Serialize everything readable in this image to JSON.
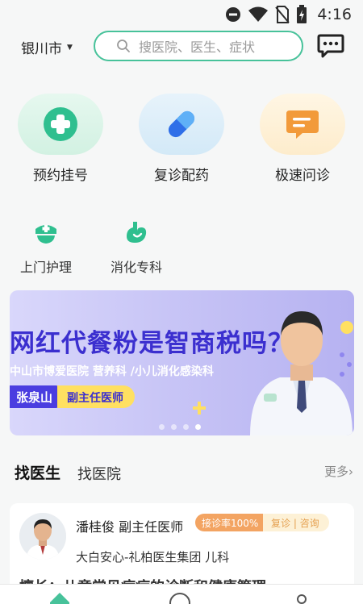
{
  "status_bar": {
    "time": "4:16",
    "icons": [
      "do-not-disturb-icon",
      "wifi-icon",
      "no-sim-icon",
      "battery-charging-icon"
    ]
  },
  "header": {
    "city": "银川市",
    "search_placeholder": "搜医院、医生、症状",
    "chat_icon": "message-bubble-icon"
  },
  "quick_actions": [
    {
      "label": "预约挂号",
      "icon": "plus-cross-icon",
      "color": "#2fbf8f"
    },
    {
      "label": "复诊配药",
      "icon": "pill-capsule-icon",
      "color": "#2f6fe8"
    },
    {
      "label": "极速问诊",
      "icon": "chat-lines-icon",
      "color": "#f29a3a"
    }
  ],
  "services": [
    {
      "label": "上门护理",
      "icon": "nurse-cap-icon"
    },
    {
      "label": "消化专科",
      "icon": "stomach-icon"
    }
  ],
  "banner": {
    "headline": "网红代餐粉是智商税吗？",
    "subtitle": "中山市博爱医院  营养科 /小儿消化感染科",
    "doctor_name": "张泉山",
    "doctor_title": "副主任医师",
    "slide_count": 4,
    "active_slide": 4
  },
  "tabs": {
    "active": "找医生",
    "other": "找医院",
    "more": "更多"
  },
  "doctor": {
    "name_title": "潘桂俊  副主任医师",
    "rate_badge": "接诊率100%",
    "service_badge": "复诊 | 咨询",
    "hospital_dept": "大白安心-礼柏医生集团 儿科",
    "expertise": "擅长：儿童常见病症的诊断和健康管理"
  },
  "colors": {
    "brand_green": "#47c29a",
    "banner_purple": "#3b2fcf",
    "badge_orange": "#f3a462"
  }
}
